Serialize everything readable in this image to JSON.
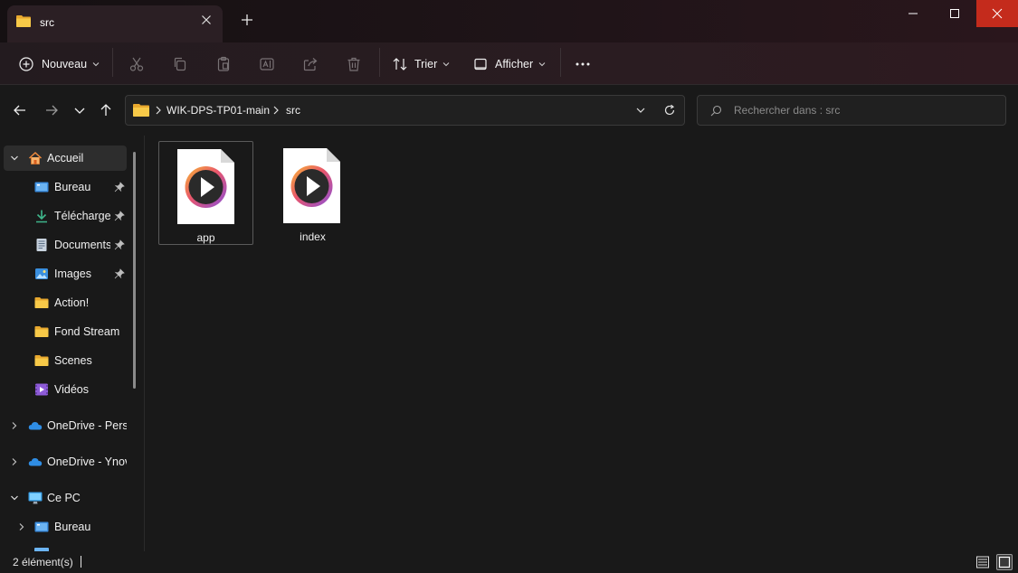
{
  "window": {
    "tab_title": "src",
    "tab_icon": "folder-icon",
    "accent_close": "#c42b1c",
    "folder_color": "#f4c542"
  },
  "toolbar": {
    "new_label": "Nouveau",
    "sort_label": "Trier",
    "view_label": "Afficher",
    "more_label": "..."
  },
  "address": {
    "segments": [
      "WIK-DPS-TP01-main",
      "src"
    ]
  },
  "search": {
    "placeholder": "Rechercher dans : src"
  },
  "sidebar": {
    "home": "Accueil",
    "quick_access": [
      {
        "label": "Bureau",
        "icon": "desktop-icon",
        "pinned": true
      },
      {
        "label": "Téléchargem",
        "icon": "download-icon",
        "pinned": true
      },
      {
        "label": "Documents",
        "icon": "documents-icon",
        "pinned": true
      },
      {
        "label": "Images",
        "icon": "images-icon",
        "pinned": true
      },
      {
        "label": "Action!",
        "icon": "folder-icon",
        "pinned": false
      },
      {
        "label": "Fond Stream",
        "icon": "folder-icon",
        "pinned": false
      },
      {
        "label": "Scenes",
        "icon": "folder-icon",
        "pinned": false
      },
      {
        "label": "Vidéos",
        "icon": "videos-icon",
        "pinned": false
      }
    ],
    "onedrive_personal": "OneDrive - Perso",
    "onedrive_ynov": "OneDrive - Ynov",
    "this_pc": "Ce PC",
    "this_pc_child": "Bureau"
  },
  "files": [
    {
      "name": "app",
      "icon": "media-file-icon",
      "selected": true
    },
    {
      "name": "index",
      "icon": "media-file-icon",
      "selected": false
    }
  ],
  "status": {
    "count": "2 élément(s)"
  }
}
